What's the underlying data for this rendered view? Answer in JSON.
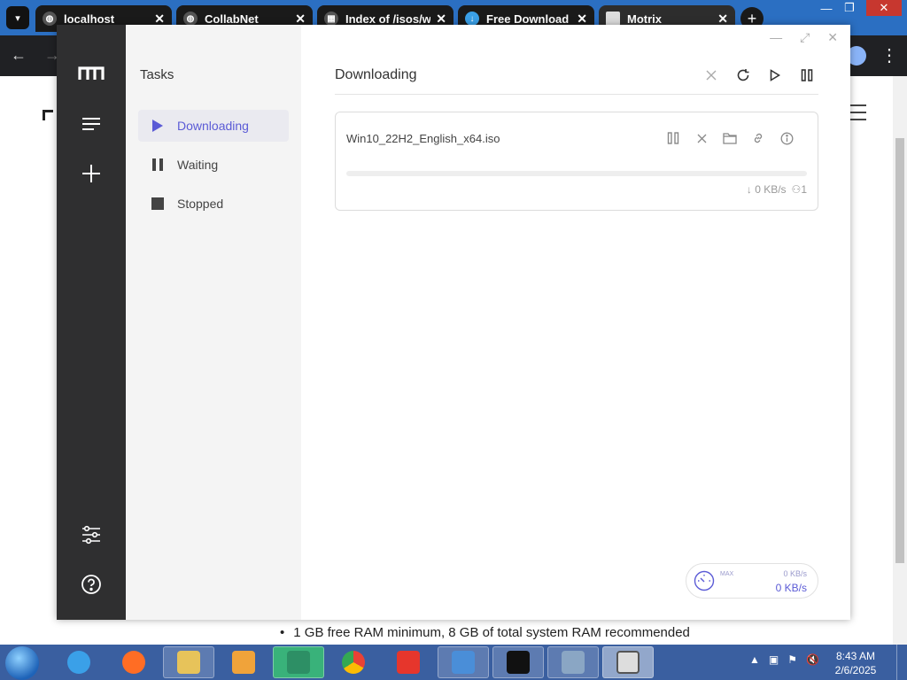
{
  "browser": {
    "tabs": [
      {
        "label": "localhost",
        "close": "✕"
      },
      {
        "label": "CollabNet",
        "close": "✕"
      },
      {
        "label": "Index of /isos/w",
        "close": "✕"
      },
      {
        "label": "Free Download",
        "close": "✕"
      },
      {
        "label": "Motrix",
        "close": "✕"
      }
    ],
    "new_tab": "+",
    "window_controls": {
      "minimize": "—",
      "restore": "❐",
      "close": "✕"
    }
  },
  "webpage": {
    "list_item": "1 GB free RAM minimum, 8 GB of total system RAM recommended"
  },
  "app": {
    "sidebar": {
      "title": "Tasks",
      "items": [
        {
          "label": "Downloading",
          "icon": "play-icon",
          "active": true
        },
        {
          "label": "Waiting",
          "icon": "pause-icon",
          "active": false
        },
        {
          "label": "Stopped",
          "icon": "stop-icon",
          "active": false
        }
      ]
    },
    "main": {
      "title": "Downloading"
    },
    "window_buttons": {
      "minimize": "—",
      "maximize": "⤢",
      "close": "✕"
    },
    "task": {
      "name": "Win10_22H2_English_x64.iso",
      "progress": 0,
      "speed": "0 KB/s",
      "connections": "1"
    },
    "speedometer": {
      "mode": "MAX",
      "upload": "0 KB/s",
      "download": "0 KB/s"
    },
    "accent_color": "#5b5bd6"
  },
  "taskbar": {
    "clock_time": "8:43 AM",
    "clock_date": "2/6/2025"
  }
}
